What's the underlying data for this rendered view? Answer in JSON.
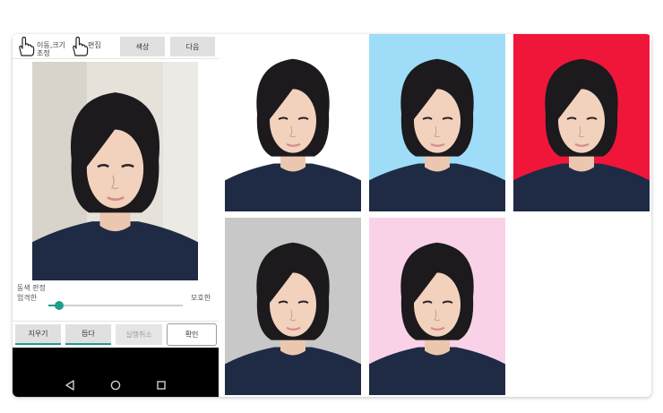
{
  "toolbar": {
    "move_resize_label": "이동,크기 조정",
    "edit_label": "편집",
    "color_button": "색상",
    "next_button": "다음"
  },
  "color_adjust": {
    "title": "동색 판정",
    "strict_label": "엄격한",
    "vague_label": "모호한",
    "slider_value": 0.08
  },
  "actions": {
    "erase": "지우기",
    "pick": "듭다",
    "undo": "실행취소",
    "confirm": "확인"
  },
  "navbar": {
    "back_icon": "back-triangle-icon",
    "home_icon": "home-circle-icon",
    "recents_icon": "recents-square-icon"
  },
  "backgrounds": {
    "preview": "#e6e2da",
    "white": "#ffffff",
    "light_blue": "#9fdcf7",
    "red": "#f0163a",
    "gray": "#c8c8c8",
    "pink": "#f9d2e8"
  },
  "accent_color": "#1e9e8a"
}
